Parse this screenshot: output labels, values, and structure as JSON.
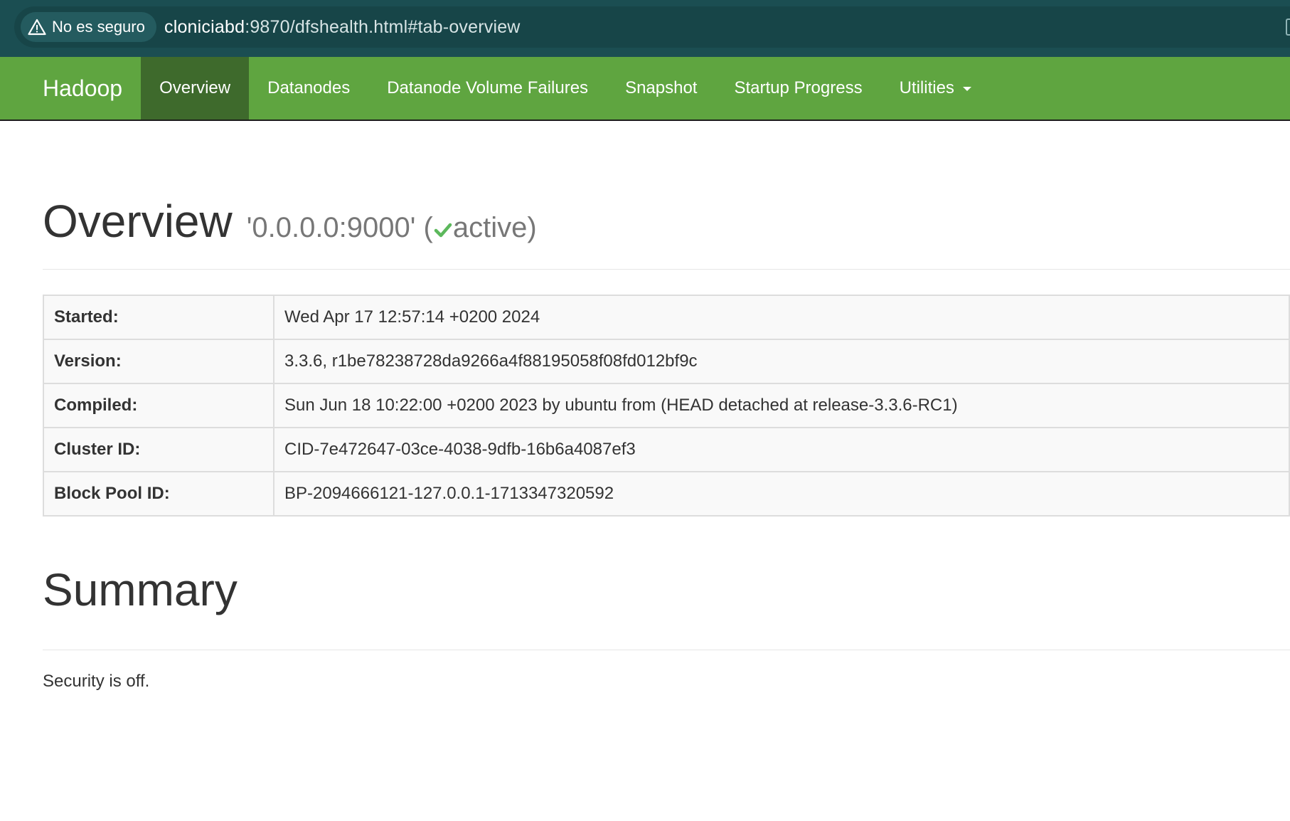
{
  "browser": {
    "security_label": "No es seguro",
    "url_host": "cloniciabd",
    "url_rest": ":9870/dfshealth.html#tab-overview"
  },
  "navbar": {
    "brand": "Hadoop",
    "items": [
      {
        "label": "Overview",
        "active": true
      },
      {
        "label": "Datanodes"
      },
      {
        "label": "Datanode Volume Failures"
      },
      {
        "label": "Snapshot"
      },
      {
        "label": "Startup Progress"
      },
      {
        "label": "Utilities"
      }
    ]
  },
  "overview": {
    "title": "Overview",
    "address": "'0.0.0.0:9000'",
    "status_open": "(",
    "status": "active)",
    "rows": [
      {
        "label": "Started:",
        "value": "Wed Apr 17 12:57:14 +0200 2024"
      },
      {
        "label": "Version:",
        "value": "3.3.6, r1be78238728da9266a4f88195058f08fd012bf9c"
      },
      {
        "label": "Compiled:",
        "value": "Sun Jun 18 10:22:00 +0200 2023 by ubuntu from (HEAD detached at release-3.3.6-RC1)"
      },
      {
        "label": "Cluster ID:",
        "value": "CID-7e472647-03ce-4038-9dfb-16b6a4087ef3"
      },
      {
        "label": "Block Pool ID:",
        "value": "BP-2094666121-127.0.0.1-1713347320592"
      }
    ]
  },
  "summary": {
    "title": "Summary",
    "security_text": "Security is off."
  },
  "colors": {
    "navbar": "#5fa540",
    "navbar_active": "#3e6a2c",
    "check": "#5cb85c"
  },
  "icons": [
    "warning-icon",
    "checkmark-icon",
    "caret-down-icon"
  ]
}
